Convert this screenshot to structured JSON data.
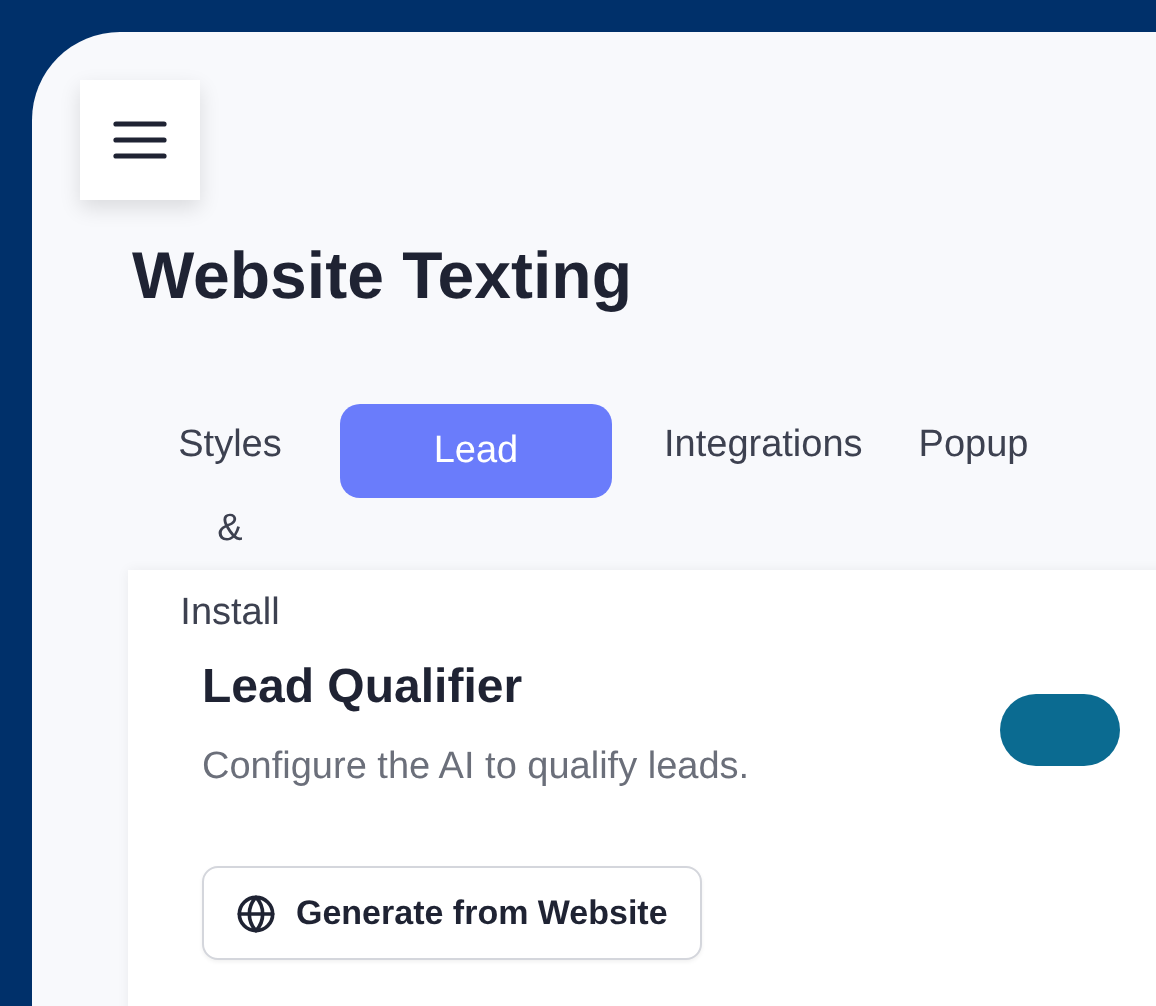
{
  "page": {
    "title": "Website Texting"
  },
  "tabs": [
    {
      "label": "Styles & Install",
      "selected": false
    },
    {
      "label": "Lead",
      "selected": true
    },
    {
      "label": "Integrations",
      "selected": false
    },
    {
      "label": "Popup",
      "selected": false
    }
  ],
  "card": {
    "title": "Lead Qualifier",
    "description": "Configure the AI to qualify leads.",
    "toggle": {
      "on": true
    },
    "button": "Generate from Website"
  }
}
